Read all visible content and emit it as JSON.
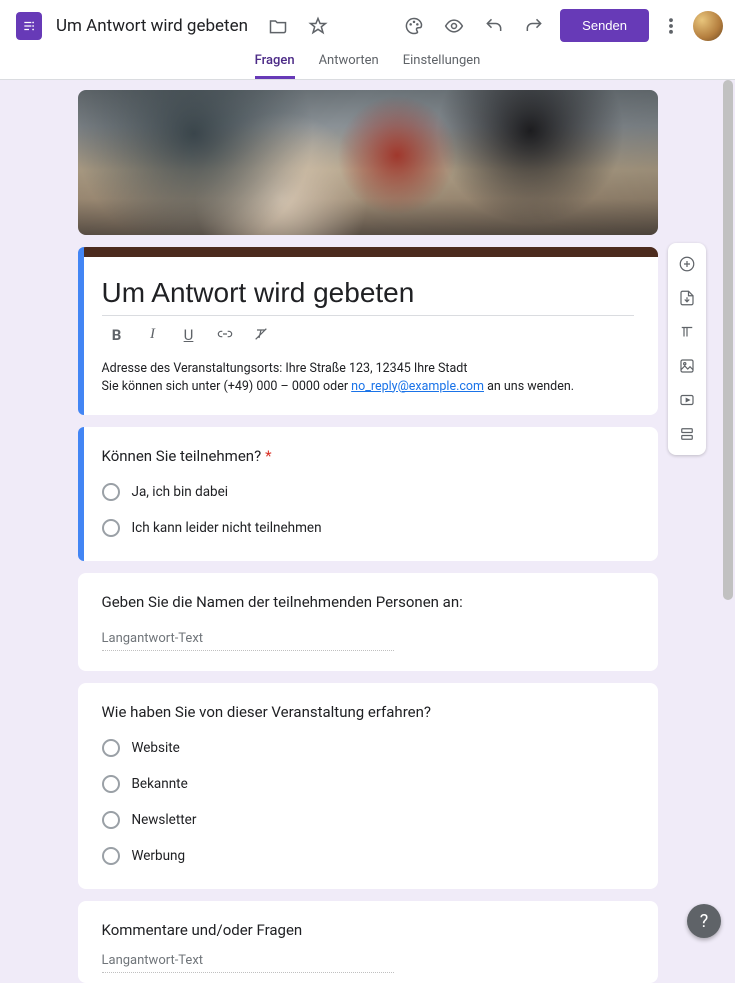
{
  "header": {
    "formTitle": "Um Antwort wird gebeten",
    "sendLabel": "Senden"
  },
  "tabs": {
    "questions": "Fragen",
    "responses": "Antworten",
    "settings": "Einstellungen"
  },
  "titleCard": {
    "title": "Um Antwort wird gebeten",
    "descLine1": "Adresse des Veranstaltungsorts: Ihre Straße 123, 12345 Ihre Stadt",
    "descLine2a": "Sie können sich unter (+49) 000 – 0000 oder ",
    "descEmail": "no_reply@example.com",
    "descLine2b": " an uns wenden."
  },
  "q1": {
    "text": "Können Sie teilnehmen?",
    "required": "*",
    "opt1": "Ja, ich bin dabei",
    "opt2": "Ich kann leider nicht teilnehmen"
  },
  "q2": {
    "text": "Geben Sie die Namen der teilnehmenden Personen an:",
    "placeholder": "Langantwort-Text"
  },
  "q3": {
    "text": "Wie haben Sie von dieser Veranstaltung erfahren?",
    "opt1": "Website",
    "opt2": "Bekannte",
    "opt3": "Newsletter",
    "opt4": "Werbung"
  },
  "q4": {
    "text": "Kommentare und/oder Fragen",
    "placeholder": "Langantwort-Text"
  },
  "help": "?"
}
